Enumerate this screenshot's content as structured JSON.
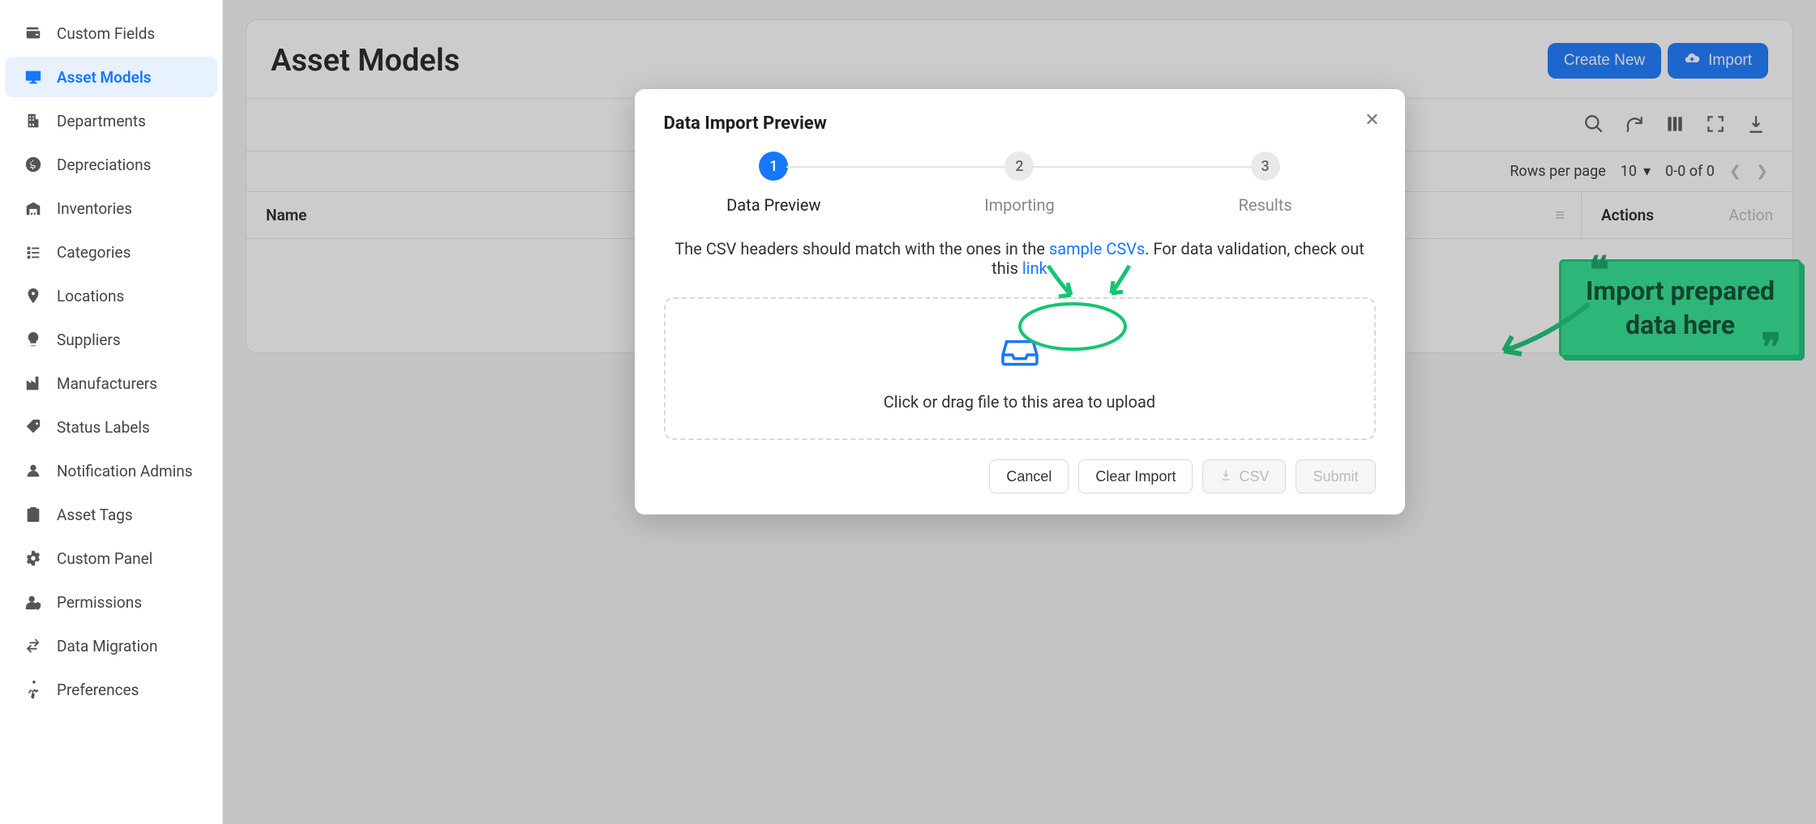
{
  "sidebar": {
    "items": [
      {
        "label": "Custom Fields",
        "icon": "wallet-icon"
      },
      {
        "label": "Asset Models",
        "icon": "monitor-icon",
        "active": true
      },
      {
        "label": "Departments",
        "icon": "building-icon"
      },
      {
        "label": "Depreciations",
        "icon": "dollar-icon"
      },
      {
        "label": "Inventories",
        "icon": "warehouse-icon"
      },
      {
        "label": "Categories",
        "icon": "list-icon"
      },
      {
        "label": "Locations",
        "icon": "map-pin-icon"
      },
      {
        "label": "Suppliers",
        "icon": "bulb-icon"
      },
      {
        "label": "Manufacturers",
        "icon": "factory-icon"
      },
      {
        "label": "Status Labels",
        "icon": "tag-icon"
      },
      {
        "label": "Notification Admins",
        "icon": "user-icon"
      },
      {
        "label": "Asset Tags",
        "icon": "clipboard-icon"
      },
      {
        "label": "Custom Panel",
        "icon": "gears-icon"
      },
      {
        "label": "Permissions",
        "icon": "user-shield-icon"
      },
      {
        "label": "Data Migration",
        "icon": "swap-icon"
      },
      {
        "label": "Preferences",
        "icon": "run-icon"
      }
    ]
  },
  "page": {
    "title": "Asset Models",
    "create_label": "Create New",
    "import_label": "Import"
  },
  "pager": {
    "rows_per_page_label": "Rows per page",
    "rows_per_page_value": "10",
    "range_text": "0-0 of 0"
  },
  "table": {
    "columns": [
      "Name",
      "Actions"
    ],
    "menu_placeholder": "Action"
  },
  "modal": {
    "title": "Data Import Preview",
    "steps": [
      {
        "num": "1",
        "label": "Data Preview"
      },
      {
        "num": "2",
        "label": "Importing"
      },
      {
        "num": "3",
        "label": "Results"
      }
    ],
    "helper_prefix": "The CSV headers should match with the ones in the ",
    "sample_link": "sample CSVs",
    "helper_mid": ". For data validation, check out this ",
    "validation_link": "link",
    "dropzone_text": "Click or drag file to this area to upload",
    "actions": {
      "cancel": "Cancel",
      "clear": "Clear Import",
      "csv": "CSV",
      "submit": "Submit"
    }
  },
  "callout": {
    "line1": "Import prepared",
    "line2": "data here"
  }
}
